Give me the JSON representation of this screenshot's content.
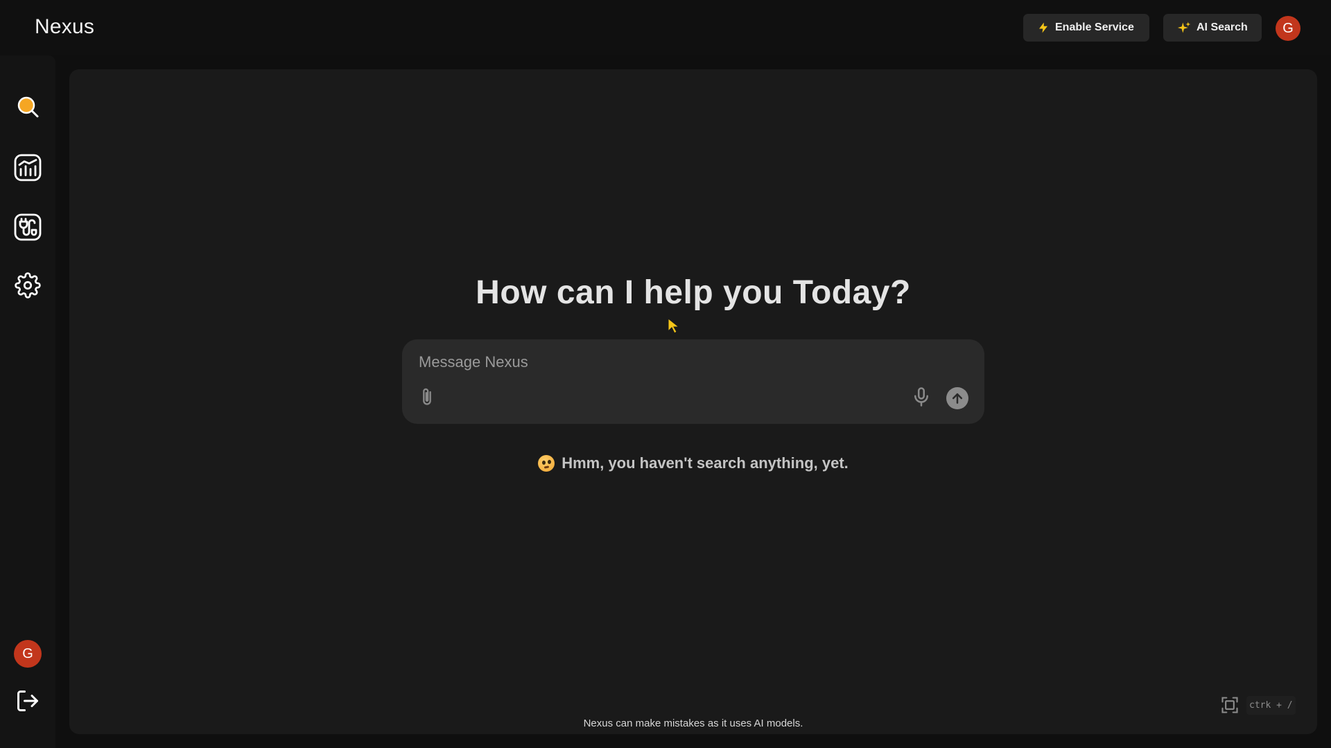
{
  "app": {
    "brand": "Nexus"
  },
  "header": {
    "enable_service_label": "Enable Service",
    "ai_search_label": "AI Search",
    "user_initial": "G"
  },
  "sidebar": {
    "items": [
      {
        "name": "search",
        "icon": "search-icon",
        "active": true,
        "accent": "#f5a623"
      },
      {
        "name": "analytics",
        "icon": "chart-icon"
      },
      {
        "name": "connections",
        "icon": "plug-icon"
      },
      {
        "name": "settings",
        "icon": "gear-icon"
      }
    ],
    "user_initial": "G",
    "logout_icon": "logout-icon"
  },
  "main": {
    "headline": "How can I help you Today?",
    "composer": {
      "placeholder": "Message Nexus",
      "attach_icon": "paperclip-icon",
      "mic_icon": "microphone-icon",
      "send_icon": "arrow-up-icon"
    },
    "empty_state": "Hmm, you haven't search anything, yet.",
    "disclaimer": "Nexus can make mistakes as it uses AI models.",
    "shortcut": {
      "icon": "screenshot-frame-icon",
      "keys": "ctrk + /"
    }
  },
  "colors": {
    "accent": "#f5a623",
    "avatar": "#c2361c",
    "background": "#0f0f0f",
    "panel": "#1a1a1a"
  }
}
